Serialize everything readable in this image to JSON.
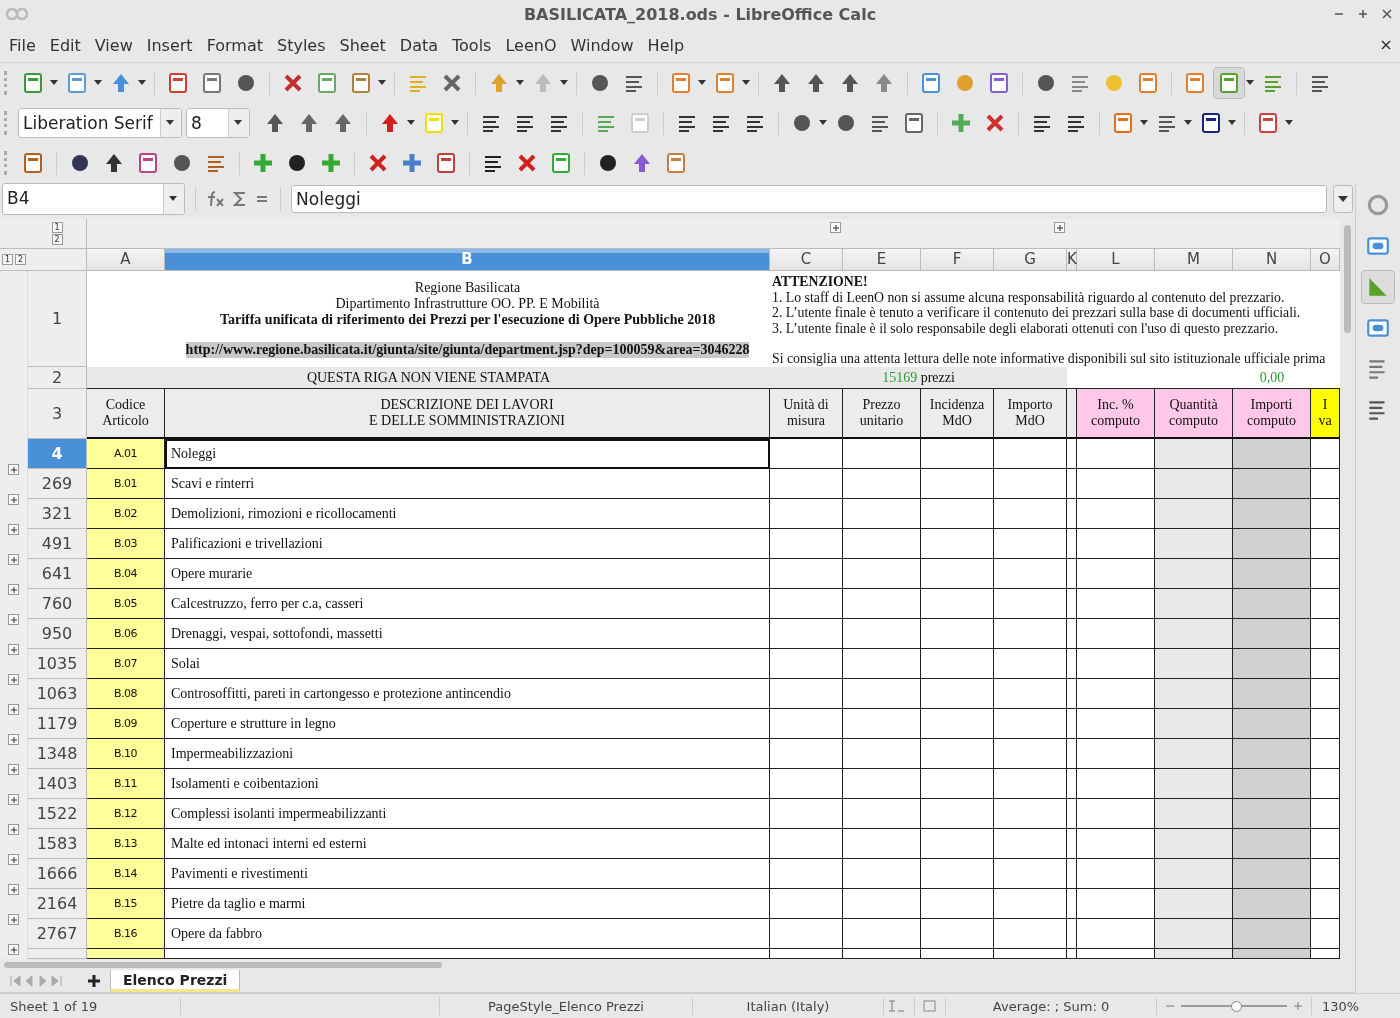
{
  "window": {
    "title": "BASILICATA_2018.ods - LibreOffice Calc"
  },
  "menu": [
    "File",
    "Edit",
    "View",
    "Insert",
    "Format",
    "Styles",
    "Sheet",
    "Data",
    "Tools",
    "LeenO",
    "Window",
    "Help"
  ],
  "formatting": {
    "font_name": "Liberation Serif",
    "font_size": "8"
  },
  "formula_bar": {
    "name_box": "B4",
    "formula": "Noleggi"
  },
  "outline": {
    "column_levels": [
      "1",
      "2"
    ],
    "row_levels": [
      "1",
      "2"
    ]
  },
  "columns": [
    {
      "label": "A",
      "selected": false
    },
    {
      "label": "B",
      "selected": true
    },
    {
      "label": "C",
      "selected": false
    },
    {
      "label": "E",
      "selected": false
    },
    {
      "label": "F",
      "selected": false
    },
    {
      "label": "G",
      "selected": false
    },
    {
      "label": "K",
      "selected": false
    },
    {
      "label": "L",
      "selected": false
    },
    {
      "label": "M",
      "selected": false
    },
    {
      "label": "N",
      "selected": false
    },
    {
      "label": "O",
      "selected": false
    }
  ],
  "title_row": {
    "number": "1",
    "title_lines": [
      "Regione Basilicata",
      "Dipartimento Infrastrutture OO. PP. E Mobilità"
    ],
    "title_bold": "Tariffa unificata di riferimento dei Prezzi per l'esecuzione di Opere Pubbliche 2018",
    "url": "http://www.regione.basilicata.it/giunta/site/giunta/department.jsp?dep=100059&area=3046228",
    "notice_title": "ATTENZIONE!",
    "notice_lines": [
      "1. Lo staff di LeenO non si assume alcuna responsabilità riguardo al contenuto del prezzario.",
      "2. L’utente finale è tenuto a verificare il contenuto dei prezzari sulla base di documenti ufficiali.",
      "3. L’utente finale è il solo responsabile degli elaborati ottenuti con l'uso di questo prezzario."
    ],
    "notice_footer": "Si consiglia una attenta lettura delle note informative disponibili sul sito istituzionale ufficiale prima"
  },
  "info_row": {
    "number": "2",
    "note": "QUESTA RIGA NON VIENE STAMPATA",
    "count": "15169",
    "count_label": "prezzi",
    "total": "0,00"
  },
  "header_row": {
    "number": "3",
    "headers": [
      {
        "lines": [
          "Codice",
          "Articolo"
        ],
        "color": "#ececec"
      },
      {
        "lines": [
          "DESCRIZIONE DEI LAVORI",
          "E DELLE SOMMINISTRAZIONI"
        ],
        "color": "#ececec"
      },
      {
        "lines": [
          "Unità di",
          "misura"
        ],
        "color": "#ececec"
      },
      {
        "lines": [
          "Prezzo",
          "unitario"
        ],
        "color": "#ececec"
      },
      {
        "lines": [
          "Incidenza",
          "MdO"
        ],
        "color": "#ececec"
      },
      {
        "lines": [
          "Importo",
          "MdO"
        ],
        "color": "#ececec"
      },
      {
        "color": "#ececec"
      },
      {
        "lines": [
          "Inc. %",
          "computo"
        ],
        "color": "#ffc8e8"
      },
      {
        "lines": [
          "Quantità",
          "computo"
        ],
        "color": "#ffc8e8"
      },
      {
        "lines": [
          "Importi",
          "computo"
        ],
        "color": "#ffc8e8"
      },
      {
        "lines": [
          "I",
          "va"
        ],
        "color": "#ffff00"
      }
    ]
  },
  "rows": [
    {
      "number": "4",
      "code": "A.01",
      "description": "Noleggi",
      "selected": true
    },
    {
      "number": "269",
      "code": "B.01",
      "description": "Scavi e rinterri",
      "selected": false
    },
    {
      "number": "321",
      "code": "B.02",
      "description": "Demolizioni, rimozioni e ricollocamenti",
      "selected": false
    },
    {
      "number": "491",
      "code": "B.03",
      "description": "Palificazioni e trivellazioni",
      "selected": false
    },
    {
      "number": "641",
      "code": "B.04",
      "description": "Opere murarie",
      "selected": false
    },
    {
      "number": "760",
      "code": "B.05",
      "description": "Calcestruzzo, ferro per c.a, casseri",
      "selected": false
    },
    {
      "number": "950",
      "code": "B.06",
      "description": "Drenaggi, vespai, sottofondi, massetti",
      "selected": false
    },
    {
      "number": "1035",
      "code": "B.07",
      "description": "Solai",
      "selected": false
    },
    {
      "number": "1063",
      "code": "B.08",
      "description": "Controsoffitti, pareti in cartongesso e protezione antincendio",
      "selected": false
    },
    {
      "number": "1179",
      "code": "B.09",
      "description": "Coperture e strutture in legno",
      "selected": false
    },
    {
      "number": "1348",
      "code": "B.10",
      "description": "Impermeabilizzazioni",
      "selected": false
    },
    {
      "number": "1403",
      "code": "B.11",
      "description": "Isolamenti e coibentazioni",
      "selected": false
    },
    {
      "number": "1522",
      "code": "B.12",
      "description": "Complessi isolanti impermeabilizzanti",
      "selected": false
    },
    {
      "number": "1583",
      "code": "B.13",
      "description": "Malte ed intonaci interni ed esterni",
      "selected": false
    },
    {
      "number": "1666",
      "code": "B.14",
      "description": "Pavimenti e rivestimenti",
      "selected": false
    },
    {
      "number": "2164",
      "code": "B.15",
      "description": "Pietre da taglio e marmi",
      "selected": false
    },
    {
      "number": "2767",
      "code": "B.16",
      "description": "Opere da fabbro",
      "selected": false
    }
  ],
  "sheet_tabs": [
    {
      "label": "Elenco Prezzi",
      "selected": true
    }
  ],
  "status_bar": {
    "sheet": "Sheet 1 of 19",
    "page_style": "PageStyle_Elenco Prezzi",
    "language": "Italian (Italy)",
    "summary": "Average: ; Sum: 0",
    "zoom": "130%",
    "zoom_slider": {
      "level": 0.52
    }
  }
}
